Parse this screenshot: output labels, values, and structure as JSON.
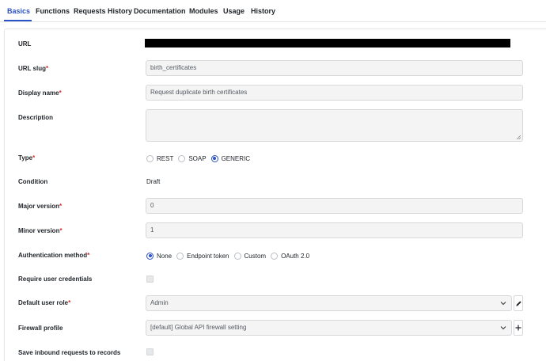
{
  "tabs": [
    {
      "label": "Basics"
    },
    {
      "label": "Functions"
    },
    {
      "label": "Requests History"
    },
    {
      "label": "Documentation"
    },
    {
      "label": "Modules"
    },
    {
      "label": "Usage"
    },
    {
      "label": "History"
    }
  ],
  "active_tab": "Basics",
  "form": {
    "url": {
      "label": "URL"
    },
    "url_slug": {
      "label": "URL slug",
      "required": "*",
      "value": "birth_certificates"
    },
    "display_name": {
      "label": "Display name",
      "required": "*",
      "value": "Request duplicate birth certificates"
    },
    "description": {
      "label": "Description",
      "value": ""
    },
    "type": {
      "label": "Type",
      "required": "*",
      "options": [
        "REST",
        "SOAP",
        "GENERIC"
      ],
      "selected": "GENERIC"
    },
    "condition": {
      "label": "Condition",
      "value": "Draft"
    },
    "major_version": {
      "label": "Major version",
      "required": "*",
      "value": "0"
    },
    "minor_version": {
      "label": "Minor version",
      "required": "*",
      "value": "1"
    },
    "auth_method": {
      "label": "Authentication method",
      "required": "*",
      "options": [
        "None",
        "Endpoint token",
        "Custom",
        "OAuth 2.0"
      ],
      "selected": "None"
    },
    "require_credentials": {
      "label": "Require user credentials",
      "checked": false
    },
    "default_user_role": {
      "label": "Default user role",
      "required": "*",
      "value": "Admin"
    },
    "firewall_profile": {
      "label": "Firewall profile",
      "value": "[default] Global API firewall setting"
    },
    "save_inbound": {
      "label": "Save inbound requests to records",
      "checked": false
    }
  },
  "colors": {
    "accent": "#2b52c4",
    "required": "#d32f2f",
    "input_bg": "#f4f4f5",
    "border": "#d6d8db"
  },
  "icons": {
    "select_chevron": "chevron-down-icon",
    "edit": "pencil-icon",
    "add": "plus-icon",
    "resize": "resize-grip-icon"
  }
}
